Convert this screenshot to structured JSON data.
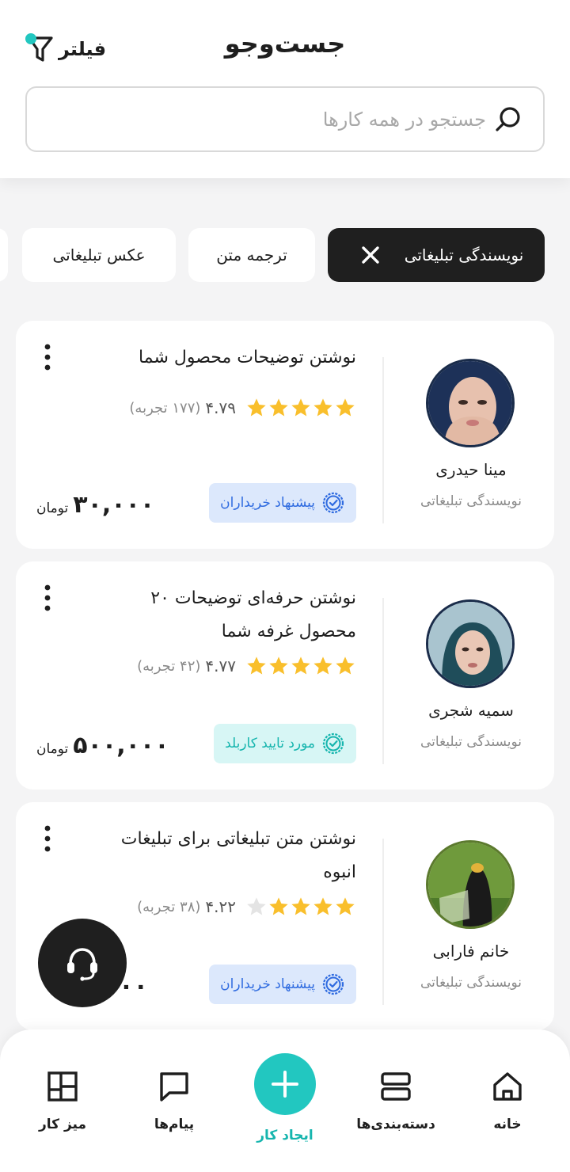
{
  "header": {
    "title": "جست‌وجو",
    "filter_label": "فیلتر",
    "search_placeholder": "جستجو در همه کارها"
  },
  "chips": [
    {
      "label": "نویسندگی تبلیغاتی",
      "active": true
    },
    {
      "label": "ترجمه متن",
      "active": false
    },
    {
      "label": "عکس تبلیغاتی",
      "active": false
    }
  ],
  "cards": [
    {
      "title": "نوشتن توضیحات محصول شما",
      "rating": "۴.۷۹",
      "reviews": "(۱۷۷ تجربه)",
      "stars": 5,
      "badge": "پیشنهاد خریداران",
      "price": "۳۰,۰۰۰",
      "currency": "تومان",
      "seller_name": "مینا حیدری",
      "seller_category": "نویسندگی تبلیغاتی"
    },
    {
      "title": "نوشتن حرفه‌ای توضیحات ۲۰ محصول غرفه شما",
      "rating": "۴.۷۷",
      "reviews": "(۴۲ تجربه)",
      "stars": 5,
      "badge": "مورد تایید کاربلد",
      "price": "۵۰۰,۰۰۰",
      "currency": "تومان",
      "seller_name": "سمیه شجری",
      "seller_category": "نویسندگی تبلیغاتی"
    },
    {
      "title": "نوشتن متن تبلیغاتی برای تبلیغات انبوه",
      "rating": "۴.۲۲",
      "reviews": "(۳۸ تجربه)",
      "stars": 4.2,
      "badge": "پیشنهاد خریداران",
      "price": "۰۰۰",
      "currency": "",
      "seller_name": "خانم فارابی",
      "seller_category": "نویسندگی تبلیغاتی"
    }
  ],
  "nav": {
    "home": "خانه",
    "categories": "دسته‌بندی‌ها",
    "create": "ایجاد کار",
    "messages": "پیام‌ها",
    "desk": "میز کار"
  },
  "colors": {
    "accent": "#22c7c0",
    "dark": "#1f1f1f",
    "star": "#f9bf2c",
    "badge_blue": "#2f6be0"
  }
}
